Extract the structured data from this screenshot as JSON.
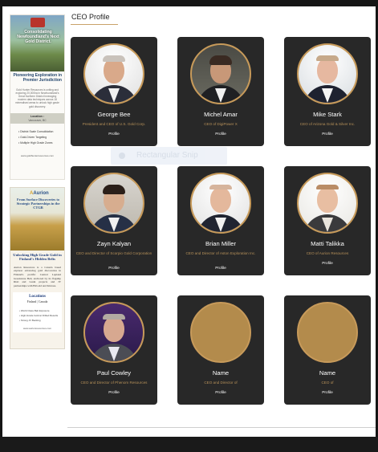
{
  "page": {
    "title": "CEO Profile"
  },
  "sidebar": {
    "ad1": {
      "headline": "Consolidating Newfoundland's Next Gold District.",
      "subheadline": "Pioneering Exploration in Premier Jurisdiction",
      "body": "Gold Hunter Resources is uniting and exploring 20,000ha in Newfoundland's Great Northern District leveraging modern data techniques across 18 mineralised areas to unlock high grade gold discovery.",
      "location_label": "Location :",
      "location_value": "Vancouver, BC",
      "bullets": [
        "District Scale Consolidation",
        "Gold-Driven Targeting",
        "Multiple High Grade Zones"
      ],
      "website": "www.goldhunterresources.com"
    },
    "ad2": {
      "logo": "Aurion",
      "tagline": "From Surface Discoveries to Strategic Partnerships in the CTGB",
      "headline": "Unlocking High Grade Gold in Finland's Hidden Belts",
      "body": "Aurion Resources is a Canada based explorer advancing gold discoveries in Finland's prolific Central Lapland Greenstone Belt, anchored by its flagship Risti and Launi projects and JV partnerships with B2Gold and Kinross.",
      "locations_label": "Locations",
      "locations_value": "Finland | Canada",
      "list": [
        "World Class Belt Exposure",
        "High-Grade Gold at Drilled Results",
        "Strong JV Backing"
      ],
      "website": "www.aurionresources.com"
    }
  },
  "watermark": {
    "label": "Rectangular Snip"
  },
  "profile_link_label": "Profile",
  "ceos": [
    {
      "name": "George Bee",
      "role": "President and CEO of U.S. Gold Corp."
    },
    {
      "name": "Michel Amar",
      "role": "CEO of DigiPower X"
    },
    {
      "name": "Mike Stark",
      "role": "CEO of Arizona Gold & Silver Inc."
    },
    {
      "name": "Zayn Kalyan",
      "role": "CEO and Director of Scorpio Gold Corporation"
    },
    {
      "name": "Brian Miller",
      "role": "CEO and Director of Aston Exploration Inc."
    },
    {
      "name": "Matti Talikka",
      "role": "CEO of Aurion Resources"
    },
    {
      "name": "Paul Cowley",
      "role": "CEO and Director of Phenom Resources"
    },
    {
      "name": "Name",
      "role": "CEO and Director of"
    },
    {
      "name": "Name",
      "role": "CEO of"
    }
  ],
  "colors": {
    "card_bg": "#282828",
    "accent_gold": "#c79a5a",
    "role_text": "#b8925a",
    "placeholder_avatar": "#b38b4c"
  }
}
